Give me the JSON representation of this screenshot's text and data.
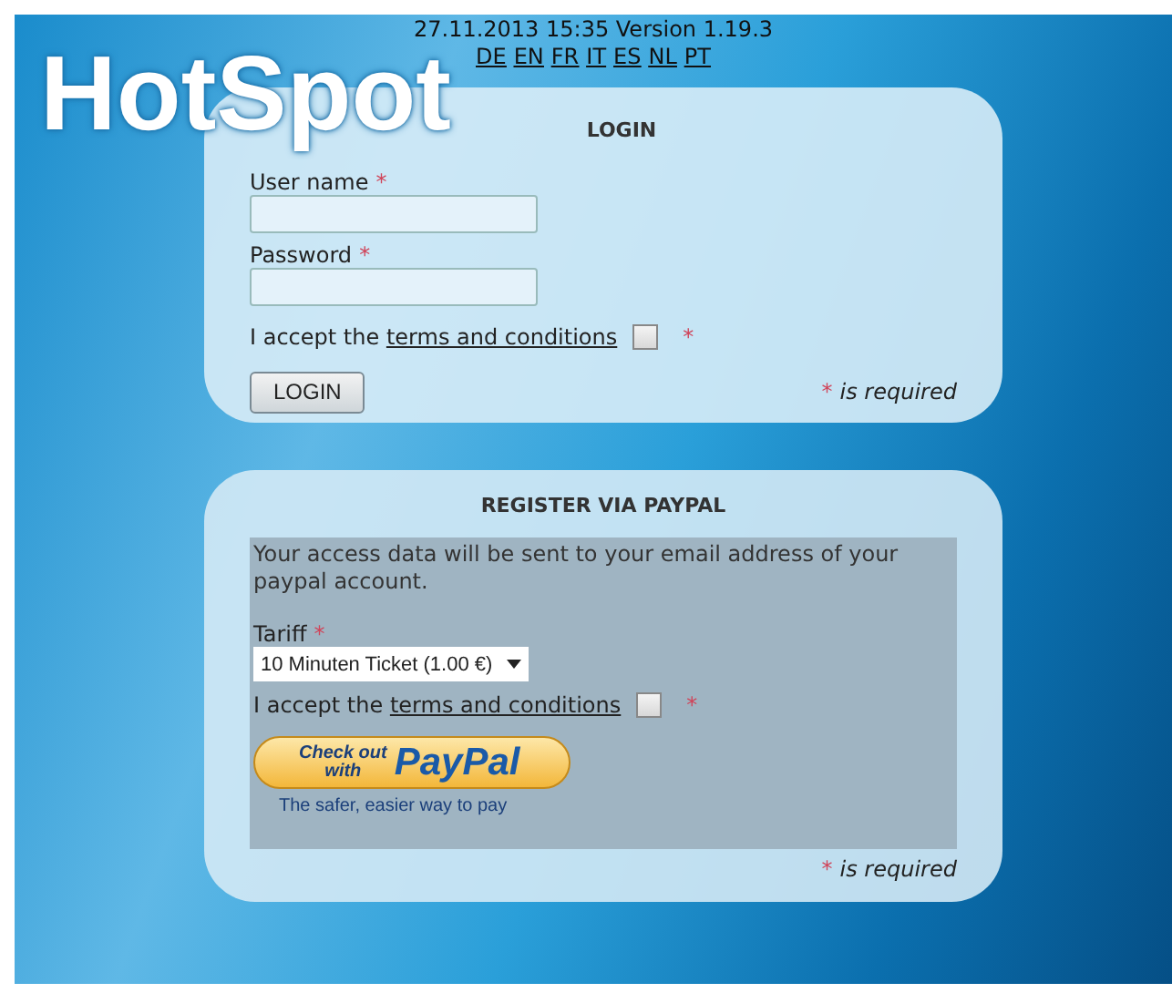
{
  "header": {
    "datetime_version": "27.11.2013 15:35 Version 1.19.3",
    "languages": [
      "DE",
      "EN",
      "FR",
      "IT",
      "ES",
      "NL",
      "PT"
    ]
  },
  "logo": "HotSpot",
  "login": {
    "title": "LOGIN",
    "fields": [
      {
        "label": "User name",
        "required_mark": "*"
      },
      {
        "label": "Password",
        "required_mark": "*"
      }
    ],
    "terms": {
      "prefix": "I accept the",
      "link": "terms and conditions",
      "checked": false,
      "required_mark": "*"
    },
    "button": "LOGIN",
    "required_note": {
      "mark": "*",
      "text": "is required"
    }
  },
  "register": {
    "title": "REGISTER VIA PAYPAL",
    "info": "Your access data will be sent to your email address of your paypal account.",
    "tariff": {
      "label": "Tariff",
      "required_mark": "*",
      "value": "10 Minuten Ticket (1.00 €)"
    },
    "terms": {
      "prefix": "I accept the",
      "link": "terms and conditions",
      "checked": false,
      "required_mark": "*"
    },
    "paypal_button": {
      "line1": "Check out",
      "line2": "with",
      "brand": "PayPal"
    },
    "paypal_tagline": "The safer, easier way to pay",
    "required_note": {
      "mark": "*",
      "text": "is required"
    }
  }
}
